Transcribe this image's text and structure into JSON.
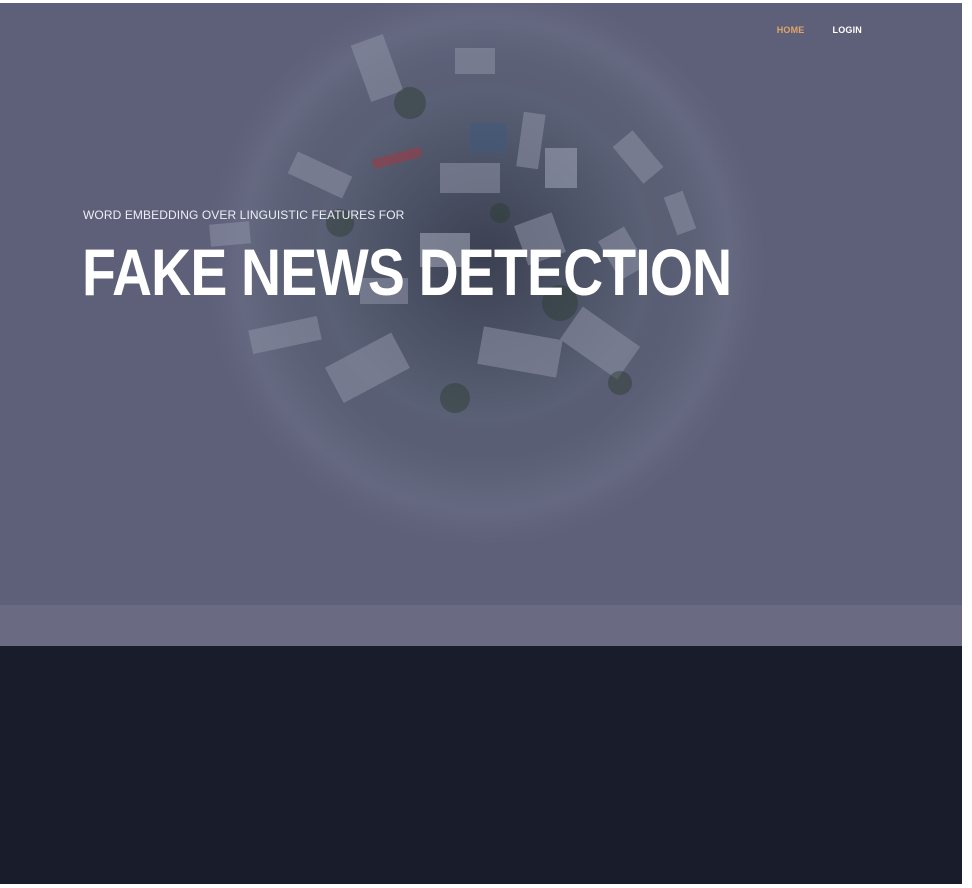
{
  "nav": {
    "items": [
      {
        "label": "HOME",
        "active": true
      },
      {
        "label": "LOGIN",
        "active": false
      }
    ]
  },
  "hero": {
    "subtitle": "WORD EMBEDDING OVER LINGUISTIC FEATURES FOR",
    "title": "FAKE NEWS DETECTION",
    "background_image": "tiny-planet-city-aerial-photo"
  },
  "colors": {
    "overlay": "#5e6079",
    "nav_active": "#e0a56a",
    "nav_default": "#ffffff",
    "band": "#6a6b82",
    "footer": "#191c2a"
  }
}
